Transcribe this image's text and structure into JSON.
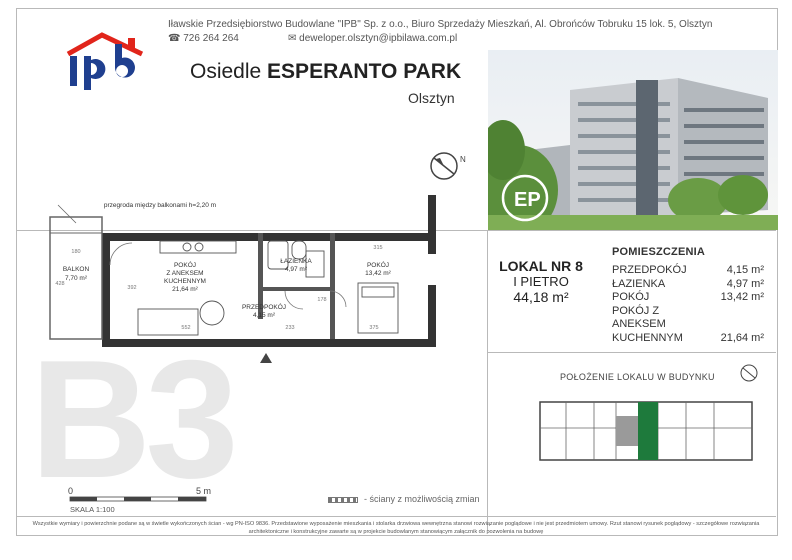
{
  "company": {
    "line1": "Iławskie Przedsiębiorstwo Budowlane \"IPB\" Sp. z o.o., Biuro Sprzedaży Mieszkań, Al. Obrońców Tobruku 15 lok. 5, Olsztyn",
    "phone": "726 264 264",
    "email": "deweloper.olsztyn@ipbilawa.com.pl",
    "logo_text": "ipb"
  },
  "project": {
    "title_prefix": "Osiedle",
    "title_name": "ESPERANTO PARK",
    "city": "Olsztyn"
  },
  "unit": {
    "number": "LOKAL NR 8",
    "floor": "I PIETRO",
    "area": "44,18 m²"
  },
  "rooms_heading": "POMIESZCZENIA",
  "rooms": [
    {
      "name": "PRZEDPOKÓJ",
      "area": "4,15 m²"
    },
    {
      "name": "ŁAZIENKA",
      "area": "4,97 m²"
    },
    {
      "name": "POKÓJ",
      "area": "13,42 m²"
    },
    {
      "name": "POKÓJ Z ANEKSEM KUCHENNYM",
      "area": "21,64 m²"
    }
  ],
  "location_heading": "POŁOŻENIE LOKALU W BUDYNKU",
  "building_code": "B3",
  "plan": {
    "partition_note": "przegroda między balkonami h=2,20 m",
    "balkon": "BALKON",
    "balkon_area": "7,70 m²",
    "pokoj_aneks_1": "POKÓJ",
    "pokoj_aneks_2": "Z ANEKSEM",
    "pokoj_aneks_3": "KUCHENNYM",
    "pokoj_aneks_area": "21,64 m²",
    "lazienka": "ŁAZIENKA",
    "lazienka_area": "4,97 m²",
    "pokoj": "POKÓJ",
    "pokoj_area": "13,42 m²",
    "przedpokoj": "PRZEDPOKÓJ",
    "przedpokoj_area": "4,15 m²",
    "dim_180": "180",
    "dim_428": "428",
    "dim_392": "392",
    "dim_552": "552",
    "dim_233": "233",
    "dim_178": "178",
    "dim_315": "315",
    "dim_375": "375"
  },
  "scale": {
    "zero": "0",
    "five": "5 m",
    "label": "SKALA 1:100"
  },
  "legend": "- ściany z możliwością zmian",
  "compass_letter": "N",
  "photo_logo": "EP",
  "footer_text": "Wszystkie wymiary i powierzchnie podane są w świetle wykończonych ścian - wg PN-ISO 9836. Przedstawione wyposażenie mieszkania i stolarka drzwiowa wewnętrzna stanowi rozwiązanie poglądowe i nie jest przedmiotem umowy. Rzut stanowi rysunek poglądowy - szczegółowe rozwiązania architektoniczne i konstrukcyjne zawarte są w projekcie budowlanym stanowiącym załącznik do pozwolenia na budowę",
  "colors": {
    "logo_red": "#e1251b",
    "logo_blue": "#1f3f8f",
    "highlight_green": "#1e7a3c",
    "frame": "#b9b9b9"
  }
}
